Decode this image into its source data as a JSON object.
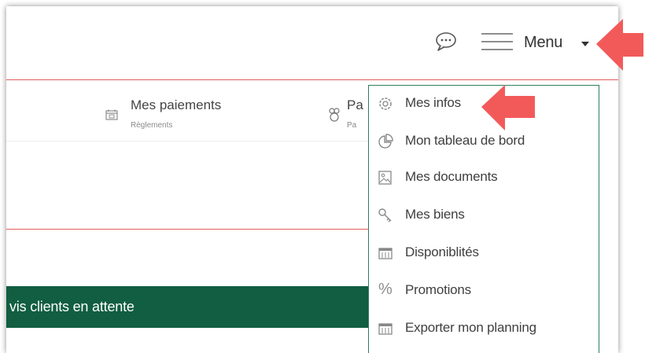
{
  "header": {
    "menu_label": "Menu",
    "icons": [
      "chat-bubble-icon",
      "hamburger-icon",
      "caret-down-icon"
    ]
  },
  "tabs": [
    {
      "title": "Mes paiements",
      "subtitle": "Règlements",
      "icon": "calendar-icon"
    },
    {
      "title": "Pa",
      "subtitle": "Pa",
      "icon": "money-bag-icon"
    }
  ],
  "banner": {
    "text": "vis clients en attente"
  },
  "dropdown": {
    "items": [
      {
        "label": "Mes infos",
        "icon": "gear-icon"
      },
      {
        "label": "Mon tableau de bord",
        "icon": "pie-chart-icon"
      },
      {
        "label": "Mes documents",
        "icon": "image-document-icon"
      },
      {
        "label": "Mes biens",
        "icon": "key-icon"
      },
      {
        "label": "Disponiblités",
        "icon": "calendar-grid-icon"
      },
      {
        "label": "Promotions",
        "icon": "percent-icon"
      },
      {
        "label": "Exporter mon planning",
        "icon": "calendar-grid-icon"
      }
    ],
    "percent_glyph": "%"
  },
  "colors": {
    "accent_green": "#115e42",
    "dropdown_border": "#2e7d5b",
    "divider_red": "#e25d5d",
    "arrow_red": "#f25a5a"
  }
}
